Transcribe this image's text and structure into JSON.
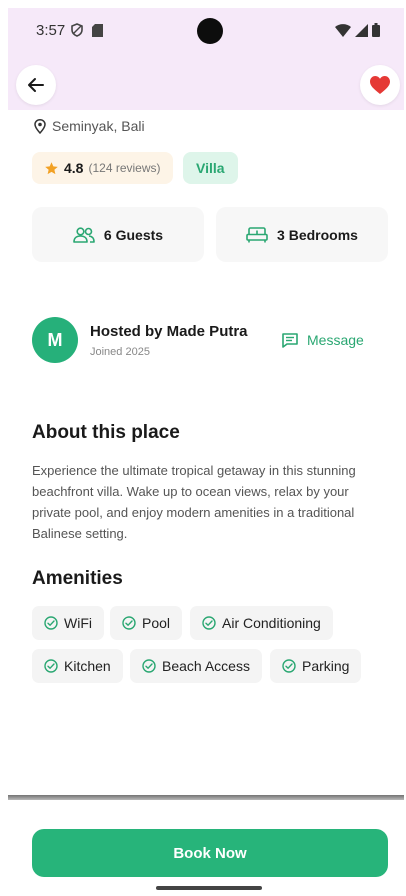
{
  "status_bar": {
    "time": "3:57"
  },
  "header": {
    "back_icon": "arrow-left-icon",
    "favorite_icon": "heart-icon",
    "favorite_color": "#e53935"
  },
  "listing": {
    "location": "Seminyak, Bali",
    "rating": "4.8",
    "reviews": "(124 reviews)",
    "type": "Villa",
    "guests": "6 Guests",
    "bedrooms": "3 Bedrooms"
  },
  "host": {
    "initial": "M",
    "name": "Hosted by Made Putra",
    "joined": "Joined 2025",
    "message_label": "Message"
  },
  "about": {
    "title": "About this place",
    "text": "Experience the ultimate tropical getaway in this stunning beachfront villa. Wake up to ocean views, relax by your private pool, and enjoy modern amenities in a traditional Balinese setting."
  },
  "amenities": {
    "title": "Amenities",
    "items": [
      "WiFi",
      "Pool",
      "Air Conditioning",
      "Kitchen",
      "Beach Access",
      "Parking"
    ]
  },
  "footer": {
    "book_label": "Book Now"
  },
  "colors": {
    "accent": "#27b47a",
    "header_bg": "#f6e9f9",
    "star": "#f2a124"
  }
}
